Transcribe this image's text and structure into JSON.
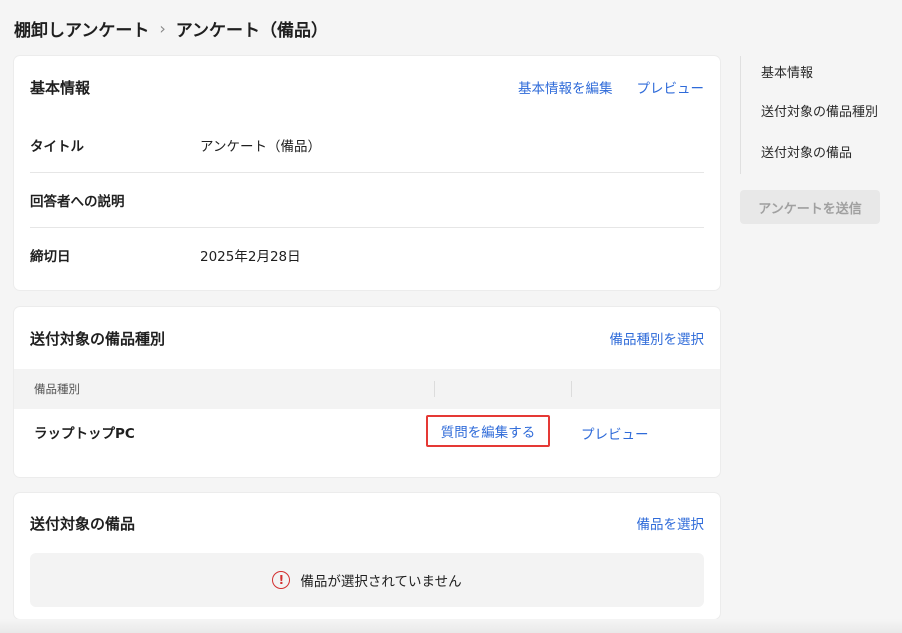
{
  "breadcrumb": {
    "parent": "棚卸しアンケート",
    "separator": "›",
    "current": "アンケート（備品）"
  },
  "basic_info": {
    "title": "基本情報",
    "edit_link": "基本情報を編集",
    "preview_link": "プレビュー",
    "rows": [
      {
        "label": "タイトル",
        "value": "アンケート（備品）"
      },
      {
        "label": "回答者への説明",
        "value": ""
      },
      {
        "label": "締切日",
        "value": "2025年2月28日"
      }
    ]
  },
  "equipment_types": {
    "title": "送付対象の備品種別",
    "select_link": "備品種別を選択",
    "column_header": "備品種別",
    "rows": [
      {
        "name": "ラップトップPC",
        "edit_label": "質問を編集する",
        "preview_label": "プレビュー"
      }
    ]
  },
  "equipment": {
    "title": "送付対象の備品",
    "select_link": "備品を選択",
    "empty_message": "備品が選択されていません",
    "empty_icon": "!"
  },
  "side_nav": {
    "items": [
      "基本情報",
      "送付対象の備品種別",
      "送付対象の備品"
    ],
    "send_button": "アンケートを送信"
  },
  "colors": {
    "link": "#2f6bd9",
    "highlight_border": "#e53935",
    "warning": "#d32f2f"
  }
}
